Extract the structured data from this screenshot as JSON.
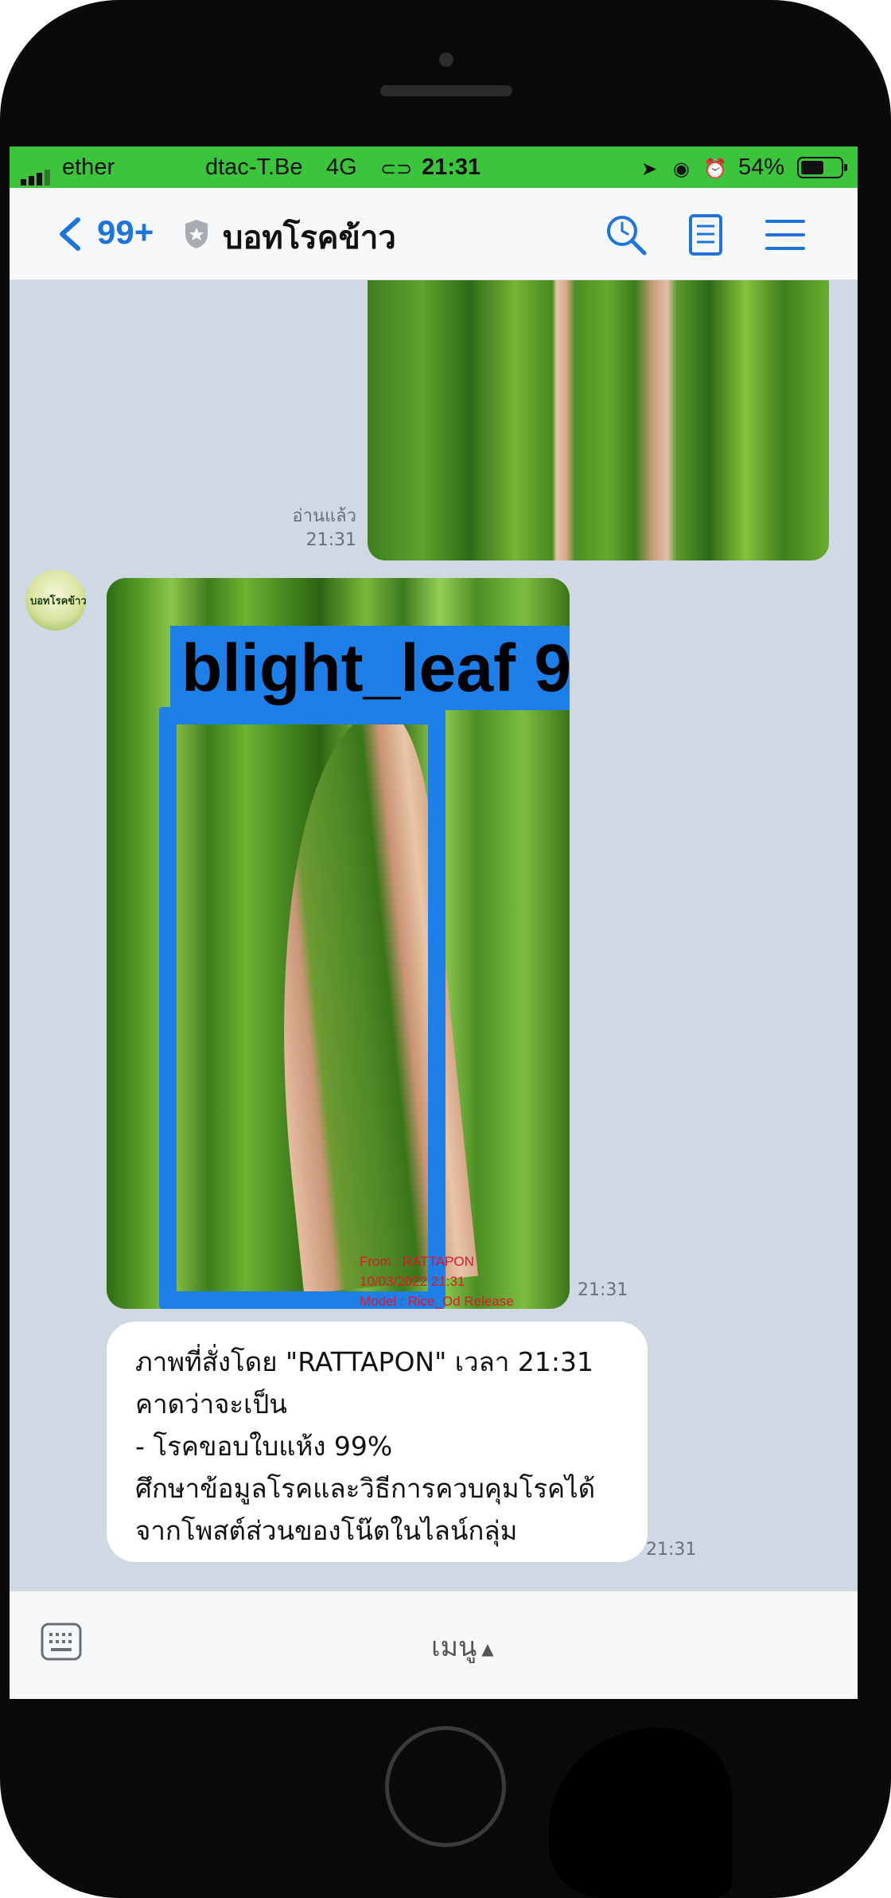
{
  "status_bar": {
    "carrier_left": "ether",
    "carrier": "dtac-T.Be",
    "network": "4G",
    "time": "21:31",
    "battery": "54%",
    "icons": [
      "signal-icon",
      "link-icon",
      "location-arrow-icon",
      "rotation-lock-icon",
      "alarm-icon",
      "battery-icon"
    ]
  },
  "header": {
    "unread_count": "99+",
    "title": "บอทโรคข้าว",
    "icons": [
      "back-chevron-icon",
      "shield-icon",
      "search-icon",
      "notes-icon",
      "menu-icon"
    ]
  },
  "messages": {
    "first_photo": {
      "read_receipt": "อ่านแล้ว",
      "time": "21:31"
    },
    "bot_photo": {
      "detection_label": "blight_leaf 9",
      "watermark_lines": [
        "From : RATTAPON",
        "10/03/2022 21:31",
        "Model : Rice_Od Release"
      ],
      "time": "21:31"
    },
    "bot_text": {
      "lines": [
        "ภาพที่สั่งโดย \"RATTAPON\" เวลา 21:31",
        "คาดว่าจะเป็น",
        " - โรคขอบใบแห้ง 99%",
        "ศึกษาข้อมูลโรคและวิธีการควบคุมโรคได้",
        "จากโพสต์ส่วนของโน๊ตในไลน์กลุ่ม"
      ],
      "time": "21:31"
    }
  },
  "bottom_bar": {
    "menu_label": "เมนู",
    "menu_arrow": "▲"
  },
  "colors": {
    "status_bar": "#3cc43c",
    "accent": "#1e74d8",
    "chat_bg": "#cfd8e3",
    "detect_box": "#1e7fe8"
  }
}
